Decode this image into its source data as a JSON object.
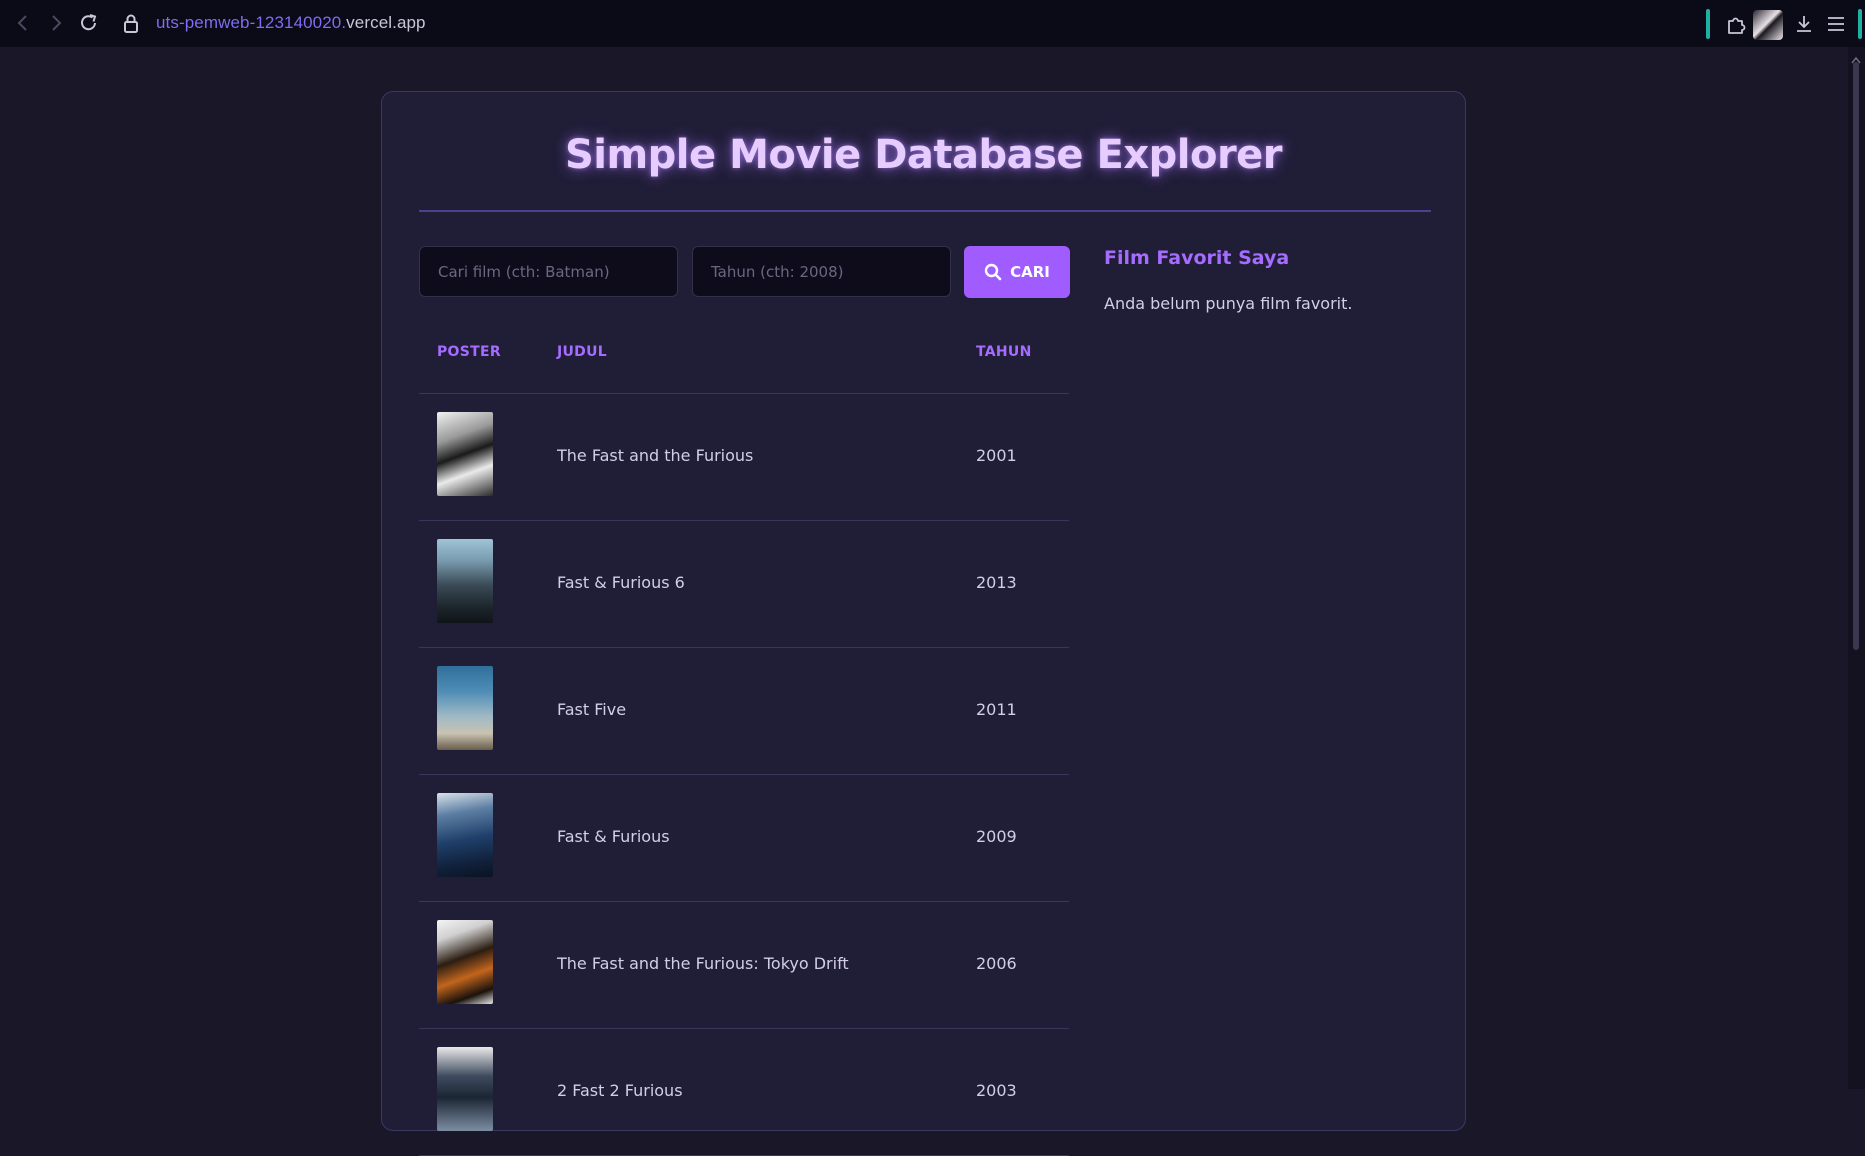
{
  "browser": {
    "url_subdomain": "uts-pemweb-123140020.",
    "url_domain": "vercel.app",
    "icons": [
      "back-icon",
      "forward-icon",
      "reload-icon",
      "lock-icon",
      "extensions-icon",
      "download-icon",
      "menu-icon"
    ]
  },
  "page": {
    "title": "Simple Movie Database Explorer"
  },
  "search": {
    "title_placeholder": "Cari film (cth: Batman)",
    "year_placeholder": "Tahun (cth: 2008)",
    "button_label": "CARI",
    "button_icon": "search-icon"
  },
  "table": {
    "headers": [
      "POSTER",
      "JUDUL",
      "TAHUN"
    ],
    "rows": [
      {
        "title": "The Fast and the Furious",
        "year": "2001"
      },
      {
        "title": "Fast & Furious 6",
        "year": "2013"
      },
      {
        "title": "Fast Five",
        "year": "2011"
      },
      {
        "title": "Fast & Furious",
        "year": "2009"
      },
      {
        "title": "The Fast and the Furious: Tokyo Drift",
        "year": "2006"
      },
      {
        "title": "2 Fast 2 Furious",
        "year": "2003"
      }
    ]
  },
  "favorites": {
    "heading": "Film Favorit Saya",
    "empty_text": "Anda belum punya film favorit."
  },
  "colors": {
    "accent": "#a15cff",
    "background": "#191728",
    "card": "#201d37"
  }
}
